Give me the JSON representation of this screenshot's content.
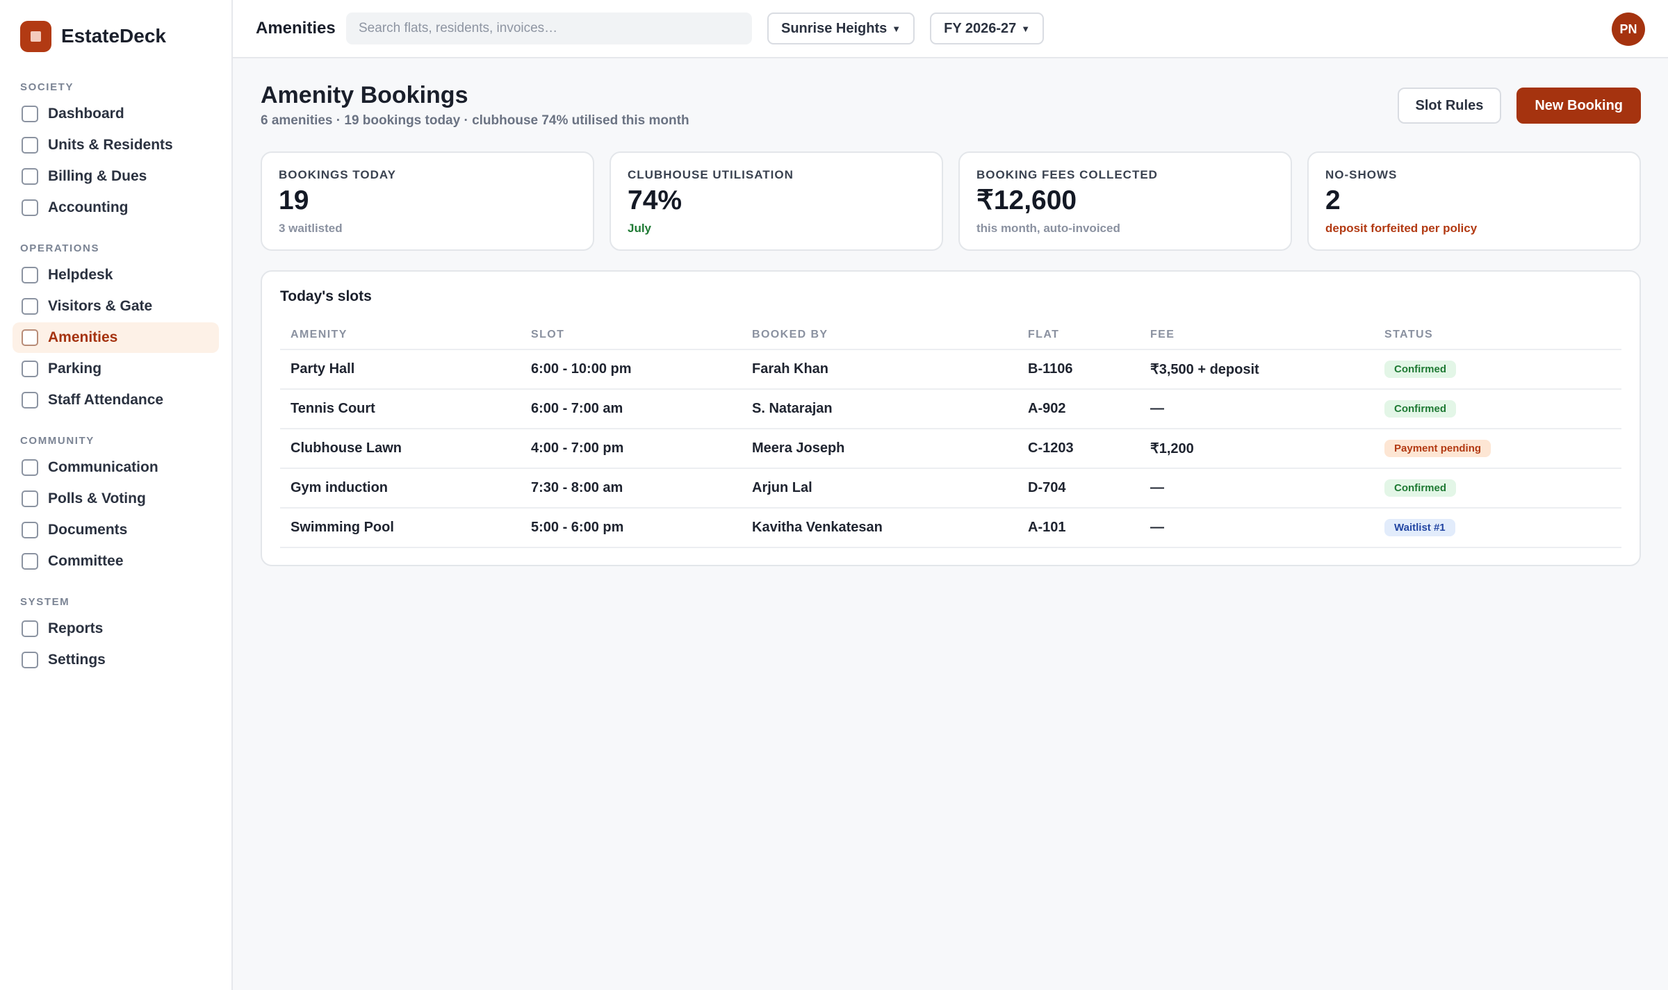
{
  "app": {
    "name": "EstateDeck"
  },
  "sidebar": {
    "sections": [
      {
        "title": "SOCIETY",
        "items": [
          {
            "label": "Dashboard",
            "active": false
          },
          {
            "label": "Units & Residents",
            "active": false
          },
          {
            "label": "Billing & Dues",
            "active": false
          },
          {
            "label": "Accounting",
            "active": false
          }
        ]
      },
      {
        "title": "OPERATIONS",
        "items": [
          {
            "label": "Helpdesk",
            "active": false
          },
          {
            "label": "Visitors & Gate",
            "active": false
          },
          {
            "label": "Amenities",
            "active": true
          },
          {
            "label": "Parking",
            "active": false
          },
          {
            "label": "Staff Attendance",
            "active": false
          }
        ]
      },
      {
        "title": "COMMUNITY",
        "items": [
          {
            "label": "Communication",
            "active": false
          },
          {
            "label": "Polls & Voting",
            "active": false
          },
          {
            "label": "Documents",
            "active": false
          },
          {
            "label": "Committee",
            "active": false
          }
        ]
      },
      {
        "title": "SYSTEM",
        "items": [
          {
            "label": "Reports",
            "active": false
          },
          {
            "label": "Settings",
            "active": false
          }
        ]
      }
    ]
  },
  "topbar": {
    "title": "Amenities",
    "search_placeholder": "Search flats, residents, invoices…",
    "society": "Sunrise Heights",
    "fiscal_year": "FY 2026-27",
    "avatar_initials": "PN"
  },
  "page": {
    "title": "Amenity Bookings",
    "subtitle": "6 amenities · 19 bookings today · clubhouse 74% utilised this month",
    "slot_rules_label": "Slot Rules",
    "new_booking_label": "New Booking"
  },
  "stats": [
    {
      "label": "BOOKINGS TODAY",
      "value": "19",
      "note": "3 waitlisted",
      "tone": "muted"
    },
    {
      "label": "CLUBHOUSE UTILISATION",
      "value": "74%",
      "note": "July",
      "tone": "green"
    },
    {
      "label": "BOOKING FEES COLLECTED",
      "value": "₹12,600",
      "note": "this month, auto-invoiced",
      "tone": "muted"
    },
    {
      "label": "NO-SHOWS",
      "value": "2",
      "note": "deposit forfeited per policy",
      "tone": "red"
    }
  ],
  "slots": {
    "title": "Today's slots",
    "columns": [
      "AMENITY",
      "SLOT",
      "BOOKED BY",
      "FLAT",
      "FEE",
      "STATUS"
    ],
    "rows": [
      {
        "amenity": "Party Hall",
        "slot": "6:00 - 10:00 pm",
        "booked_by": "Farah Khan",
        "flat": "B-1106",
        "fee": "₹3,500 + deposit",
        "status": "Confirmed",
        "status_tone": "green"
      },
      {
        "amenity": "Tennis Court",
        "slot": "6:00 - 7:00 am",
        "booked_by": "S. Natarajan",
        "flat": "A-902",
        "fee": "—",
        "status": "Confirmed",
        "status_tone": "green"
      },
      {
        "amenity": "Clubhouse Lawn",
        "slot": "4:00 - 7:00 pm",
        "booked_by": "Meera Joseph",
        "flat": "C-1203",
        "fee": "₹1,200",
        "status": "Payment pending",
        "status_tone": "orange"
      },
      {
        "amenity": "Gym induction",
        "slot": "7:30 - 8:00 am",
        "booked_by": "Arjun Lal",
        "flat": "D-704",
        "fee": "—",
        "status": "Confirmed",
        "status_tone": "green"
      },
      {
        "amenity": "Swimming Pool",
        "slot": "5:00 - 6:00 pm",
        "booked_by": "Kavitha Venkatesan",
        "flat": "A-101",
        "fee": "—",
        "status": "Waitlist #1",
        "status_tone": "blue"
      }
    ]
  }
}
